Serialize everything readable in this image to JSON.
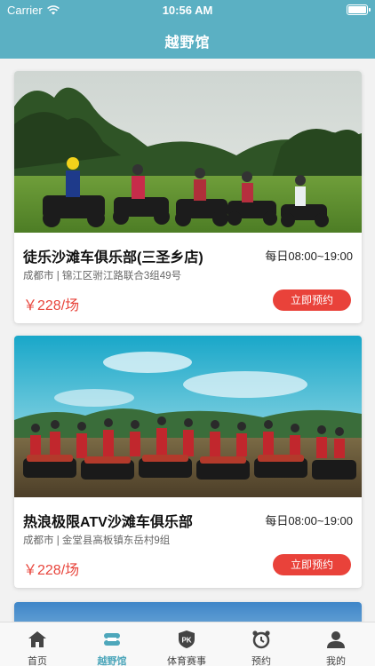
{
  "status": {
    "carrier": "Carrier",
    "time": "10:56 AM"
  },
  "header": {
    "title": "越野馆"
  },
  "venues": [
    {
      "name": "徒乐沙滩车俱乐部(三圣乡店)",
      "hours": "每日08:00~19:00",
      "address": "成都市 | 锦江区驸江路联合3组49号",
      "price": "￥228/场",
      "book_label": "立即预约"
    },
    {
      "name": "热浪极限ATV沙滩车俱乐部",
      "hours": "每日08:00~19:00",
      "address": "成都市 | 金堂县高板镇东岳村9组",
      "price": "￥228/场",
      "book_label": "立即预约"
    }
  ],
  "tabs": [
    {
      "label": "首页",
      "icon": "home-icon"
    },
    {
      "label": "越野馆",
      "icon": "atv-icon",
      "active": true
    },
    {
      "label": "体育赛事",
      "icon": "pk-shield-icon"
    },
    {
      "label": "预约",
      "icon": "alarm-clock-icon"
    },
    {
      "label": "我的",
      "icon": "person-icon"
    }
  ],
  "colors": {
    "header": "#5bb0c3",
    "accent": "#e9423a",
    "active_tab": "#4ea7bb"
  }
}
